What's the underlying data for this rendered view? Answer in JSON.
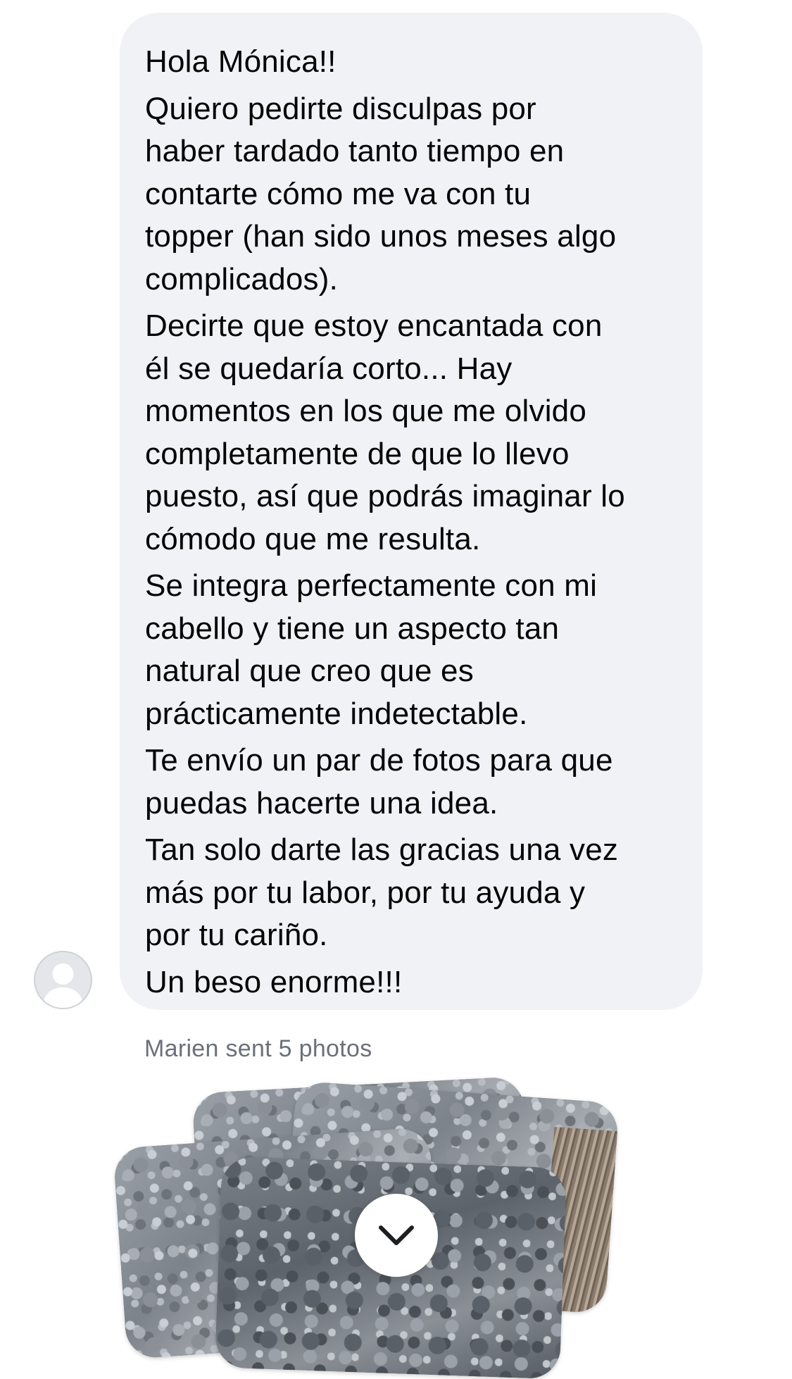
{
  "message": {
    "paragraphs": [
      "Hola Mónica!!",
      "Quiero pedirte disculpas por\nhaber tardado tanto tiempo en\ncontarte cómo me va con tu\ntopper (han sido unos meses algo\ncomplicados).",
      "Decirte que estoy encantada con\nél se quedaría corto... Hay\nmomentos en los que me olvido\ncompletamente de que lo llevo\npuesto, así que podrás imaginar lo\ncómodo que me resulta.",
      "Se integra perfectamente con mi\ncabello y tiene un aspecto tan\nnatural que creo que es\nprácticamente indetectable.",
      "Te envío un par de fotos para que\npuedas hacerte una idea.",
      "Tan solo darte las gracias una vez\nmás por tu labor, por tu ayuda y\npor tu cariño.",
      "Un beso enorme!!!"
    ]
  },
  "photos": {
    "sent_label": "Marien sent 5 photos"
  },
  "icons": {
    "avatar": "default-avatar-icon",
    "expand": "chevron-down-icon"
  },
  "colors": {
    "bubble": "#f1f2f5",
    "text": "#050505",
    "meta_text": "#6b7079"
  }
}
